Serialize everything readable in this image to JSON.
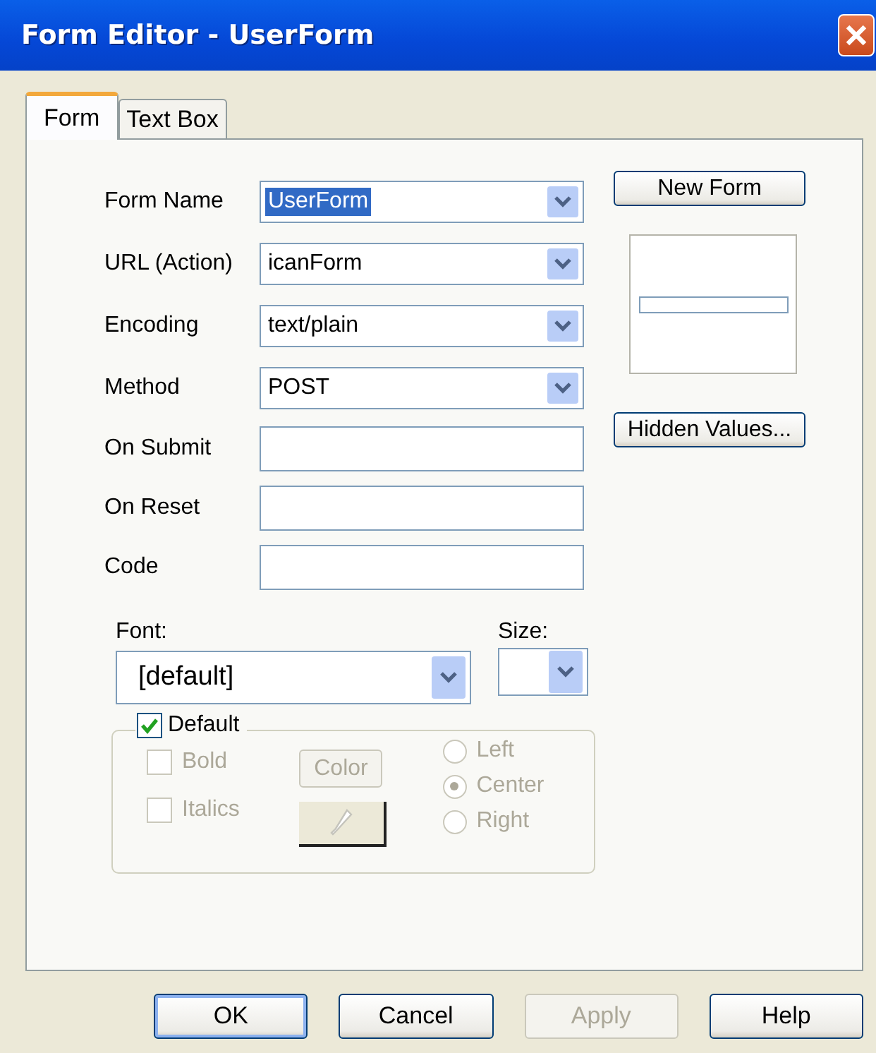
{
  "window": {
    "title": "Form Editor - UserForm"
  },
  "tabs": [
    {
      "label": "Form",
      "selected": true
    },
    {
      "label": "Text Box",
      "selected": false
    }
  ],
  "fields": [
    {
      "kind": "combo",
      "label": "Form Name",
      "value": "UserForm",
      "highlighted": true
    },
    {
      "kind": "combo",
      "label": "URL (Action)",
      "value": "icanForm",
      "highlighted": false
    },
    {
      "kind": "combo",
      "label": "Encoding",
      "value": "text/plain",
      "highlighted": false
    },
    {
      "kind": "combo",
      "label": "Method",
      "value": "POST",
      "highlighted": false
    },
    {
      "kind": "text",
      "label": "On Submit"
    },
    {
      "kind": "text",
      "label": "On Reset"
    },
    {
      "kind": "text",
      "label": "Code"
    }
  ],
  "side_buttons": [
    "New Form",
    "Hidden Values..."
  ],
  "font": {
    "label": "Font:",
    "value": "[default]"
  },
  "size": {
    "label": "Size:"
  },
  "style_group": {
    "default": {
      "label": "Default",
      "checked": true,
      "disabled": false
    },
    "options": [
      {
        "label": "Bold",
        "checked": false,
        "disabled": true
      },
      {
        "label": "Italics",
        "checked": false,
        "disabled": true
      }
    ],
    "color_button": {
      "label": "Color",
      "disabled": true
    },
    "alignment": [
      {
        "label": "Left",
        "selected": false,
        "disabled": true
      },
      {
        "label": "Center",
        "selected": true,
        "disabled": true
      },
      {
        "label": "Right",
        "selected": false,
        "disabled": true
      }
    ]
  },
  "buttons": [
    {
      "label": "OK",
      "disabled": false,
      "default": true
    },
    {
      "label": "Cancel",
      "disabled": false,
      "default": false
    },
    {
      "label": "Apply",
      "disabled": true,
      "default": false
    },
    {
      "label": "Help",
      "disabled": false,
      "default": false
    }
  ]
}
